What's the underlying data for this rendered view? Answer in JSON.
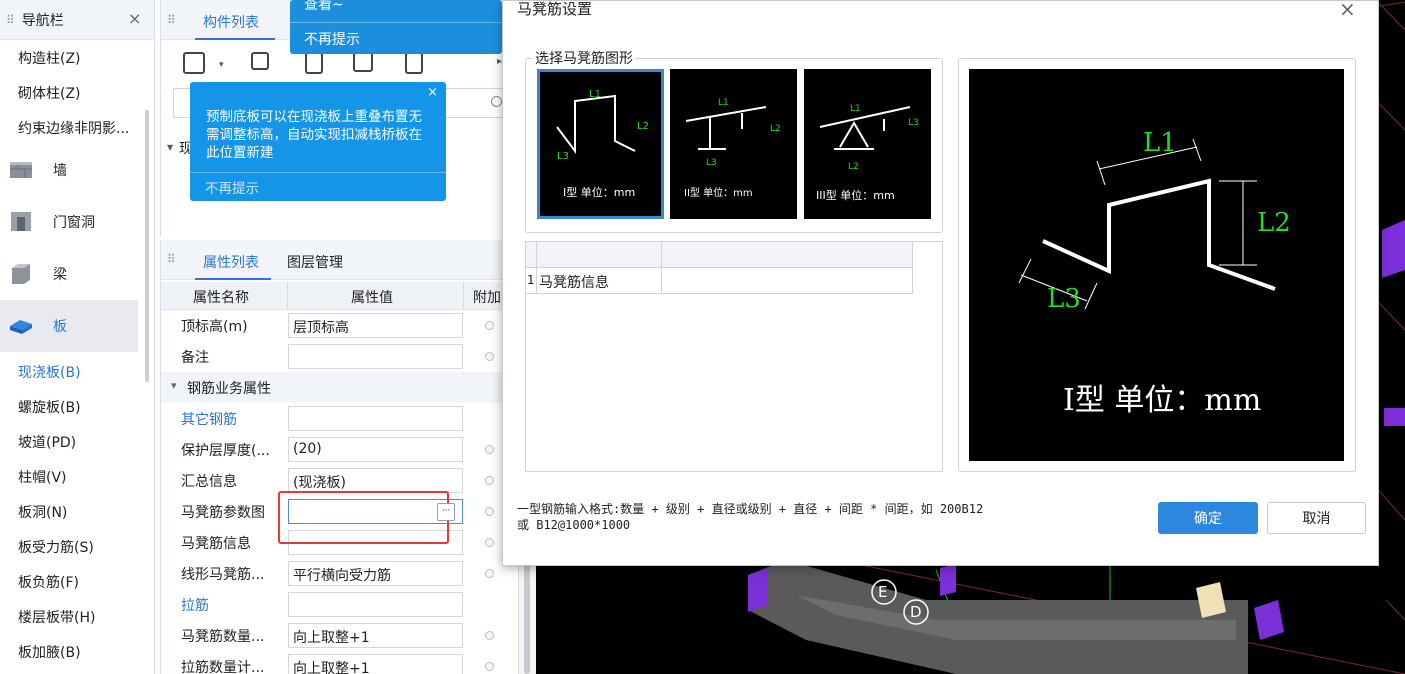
{
  "nav": {
    "title": "导航栏",
    "close": "×",
    "items_top": [
      "构造柱(Z)",
      "砌体柱(Z)",
      "约束边缘非阴影..."
    ],
    "categories": [
      "墙",
      "门窗洞",
      "梁",
      "板"
    ],
    "items_bottom": [
      "现浇板(B)",
      "螺旋板(B)",
      "坡道(PD)",
      "柱帽(V)",
      "板洞(N)",
      "板受力筋(S)",
      "板负筋(F)",
      "楼层板带(H)",
      "板加腋(B)"
    ]
  },
  "component_list": {
    "tab": "构件列表",
    "tree_text": "现",
    "search_letter": "搜"
  },
  "tooltip_main": {
    "message": "预制底板可以在现浇板上重叠布置无需调整标高，自动实现扣减栈桥板在此位置新建",
    "close": "×",
    "dismiss": "不再提示"
  },
  "tooltip_top": {
    "text1": "查看~",
    "dismiss": "不再提示"
  },
  "properties": {
    "tab1": "属性列表",
    "tab2": "图层管理",
    "col_name": "属性名称",
    "col_value": "属性值",
    "col_extra": "附加",
    "rows": [
      {
        "name": "顶标高(m)",
        "value": "层顶标高",
        "blue": false
      },
      {
        "name": "备注",
        "value": "",
        "blue": false
      },
      {
        "name": "钢筋业务属性",
        "value": "",
        "group": true
      },
      {
        "name": "其它钢筋",
        "value": "",
        "blue": true
      },
      {
        "name": "保护层厚度(...",
        "value": "(20)",
        "blue": false
      },
      {
        "name": "汇总信息",
        "value": "(现浇板)",
        "blue": false
      },
      {
        "name": "马凳筋参数图",
        "value": "",
        "blue": false
      },
      {
        "name": "马凳筋信息",
        "value": "",
        "blue": false
      },
      {
        "name": "线形马凳筋...",
        "value": "平行横向受力筋",
        "blue": false
      },
      {
        "name": "拉筋",
        "value": "",
        "blue": true
      },
      {
        "name": "马凳筋数量...",
        "value": "向上取整+1",
        "blue": false
      },
      {
        "name": "拉筋数量计...",
        "value": "向上取整+1",
        "blue": false
      }
    ]
  },
  "dialog": {
    "title": "马凳筋设置",
    "close": "×",
    "group_label": "选择马凳筋图形",
    "shapes": [
      {
        "label": "I型 单位：mm",
        "selected": true
      },
      {
        "label": "II型 单位：mm",
        "selected": false
      },
      {
        "label": "III型 单位：mm",
        "selected": false
      }
    ],
    "table": {
      "row_num": "1",
      "row_label": "马凳筋信息"
    },
    "preview": {
      "L1": "L1",
      "L2": "L2",
      "L3": "L3",
      "caption": "I型 单位：mm"
    },
    "hint_line1": "一型钢筋输入格式:数量 + 级别 + 直径或级别 + 直径 + 间距 * 间距，如 200B12",
    "hint_line2": "或 B12@1000*1000",
    "ok": "确定",
    "cancel": "取消"
  },
  "cad": {
    "axis_e": "E",
    "axis_d": "D"
  },
  "colors": {
    "accent": "#2d87dc",
    "tooltip": "#1595e8",
    "highlight": "#e53935",
    "cad_green": "#22dd22",
    "cad_purple": "#7b2fd9"
  }
}
